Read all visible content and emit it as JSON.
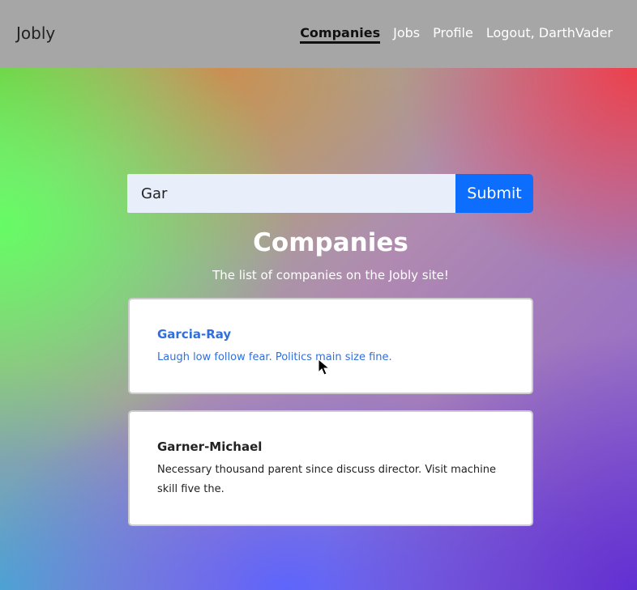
{
  "navbar": {
    "brand": "Jobly",
    "links": [
      {
        "label": "Companies",
        "active": true
      },
      {
        "label": "Jobs",
        "active": false
      },
      {
        "label": "Profile",
        "active": false
      },
      {
        "label": "Logout, DarthVader",
        "active": false
      }
    ]
  },
  "search": {
    "value": "Gar",
    "button_label": "Submit"
  },
  "page": {
    "title": "Companies",
    "subtitle": "The list of companies on the Jobly site!"
  },
  "companies": [
    {
      "name": "Garcia-Ray",
      "description": "Laugh low follow fear. Politics main size fine."
    },
    {
      "name": "Garner-Michael",
      "description": "Necessary thousand parent since discuss director. Visit machine skill five the."
    }
  ],
  "colors": {
    "navbar_bg": "#a6a6a6",
    "primary": "#0d6efd",
    "link_hover": "#2f6fde"
  }
}
